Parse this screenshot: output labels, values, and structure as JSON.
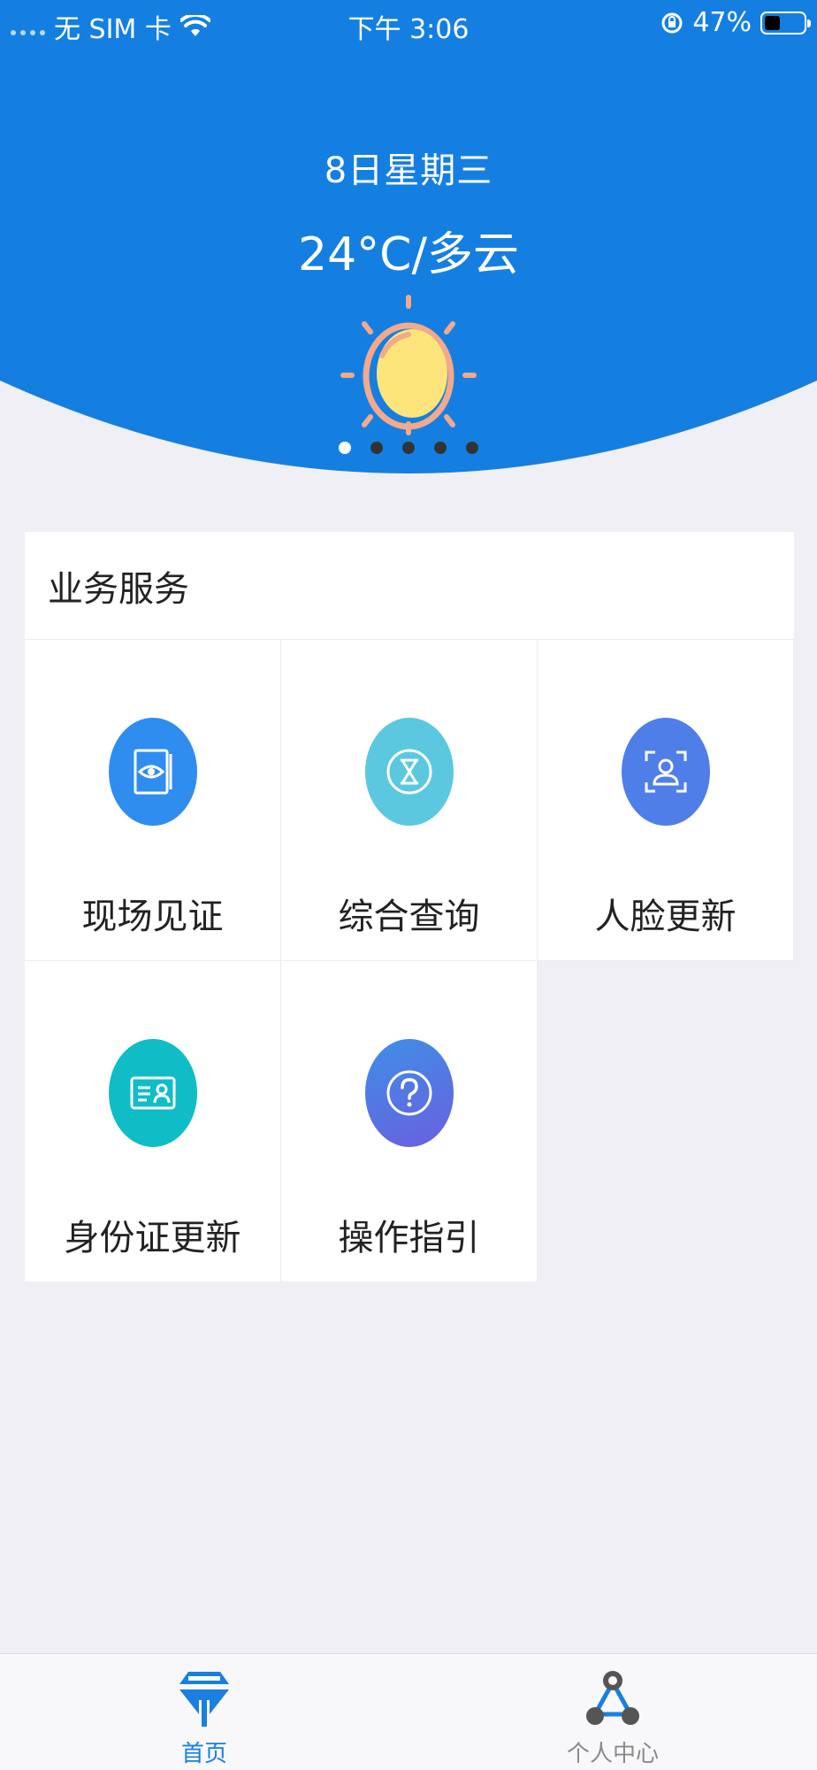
{
  "status_bar": {
    "carrier": "无 SIM 卡",
    "time": "下午 3:06",
    "battery": "47%",
    "battery_level": 0.47
  },
  "weather": {
    "date": "8日星期三",
    "summary": "24°C/多云",
    "icon": "sun-icon",
    "pager_count": 5,
    "pager_active": 0
  },
  "services": {
    "title": "业务服务",
    "items": [
      {
        "label": "现场见证",
        "icon": "eye-document-icon",
        "color": "#2f8df0"
      },
      {
        "label": "综合查询",
        "icon": "hourglass-icon",
        "color": "#5cc8e0"
      },
      {
        "label": "人脸更新",
        "icon": "face-scan-icon",
        "color": "#4f7ee8"
      },
      {
        "label": "身份证更新",
        "icon": "id-card-icon",
        "color": "#0fbdc6"
      },
      {
        "label": "操作指引",
        "icon": "question-icon",
        "color": "#5b6fe0"
      }
    ]
  },
  "tabbar": {
    "tabs": [
      {
        "label": "首页",
        "icon": "home-icon",
        "active": true
      },
      {
        "label": "个人中心",
        "icon": "profile-icon",
        "active": false
      }
    ]
  },
  "colors": {
    "primary": "#1a7fe0",
    "background": "#f0eff5"
  }
}
